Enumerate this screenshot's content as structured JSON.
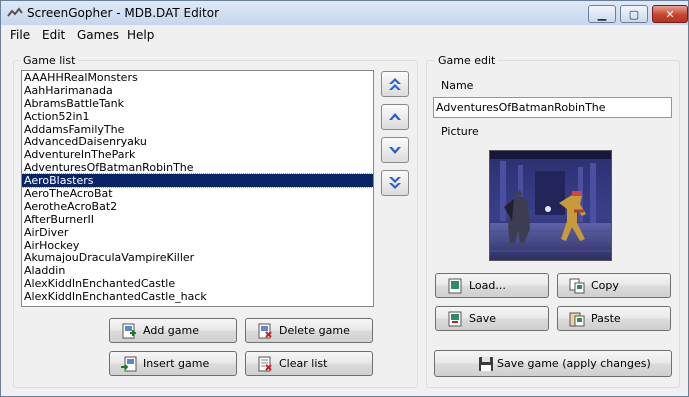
{
  "window": {
    "title": "ScreenGopher - MDB.DAT Editor",
    "controls": {
      "minimize": "▁",
      "maximize": "▢",
      "close": "✕"
    }
  },
  "menu": [
    "File",
    "Edit",
    "Games",
    "Help"
  ],
  "game_list": {
    "label": "Game list",
    "selected_index": 8,
    "items": [
      "AAAHHRealMonsters",
      "AahHarimanada",
      "AbramsBattleTank",
      "Action52in1",
      "AddamsFamilyThe",
      "AdvancedDaisenryaku",
      "AdventureInThePark",
      "AdventuresOfBatmanRobinThe",
      "AeroBlasters",
      "AeroTheAcroBat",
      "AerotheAcroBat2",
      "AfterBurnerII",
      "AirDiver",
      "AirHockey",
      "AkumajouDraculaVampireKiller",
      "Aladdin",
      "AlexKiddInEnchantedCastle",
      "AlexKiddInEnchantedCastle_hack"
    ]
  },
  "move_buttons": {
    "top": "double-up-arrow-icon",
    "up": "up-arrow-icon",
    "down": "down-arrow-icon",
    "bottom": "double-down-arrow-icon"
  },
  "list_buttons": {
    "add": "Add game",
    "delete": "Delete game",
    "insert": "Insert game",
    "clear": "Clear list"
  },
  "game_edit": {
    "label": "Game edit",
    "name_label": "Name",
    "name_value": "AdventuresOfBatmanRobinThe",
    "picture_label": "Picture",
    "load": "Load...",
    "copy": "Copy",
    "save": "Save",
    "paste": "Paste",
    "save_game": "Save game (apply changes)"
  },
  "colors": {
    "selection": "#0a246a",
    "accent": "#2a62c9"
  }
}
